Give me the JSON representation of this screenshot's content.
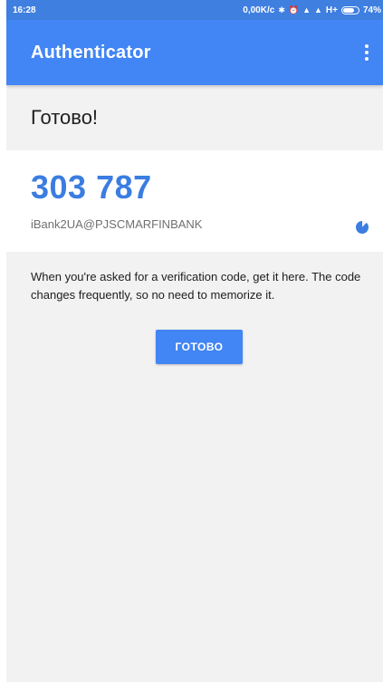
{
  "status_bar": {
    "time": "16:28",
    "network_speed": "0,00K/c",
    "network_type": "H+",
    "battery": "74%",
    "battery_level": 0.74
  },
  "app_bar": {
    "title": "Authenticator"
  },
  "heading": "Готово!",
  "account": {
    "code": "303 787",
    "name": "iBank2UA@PJSCMARFINBANK"
  },
  "info_text": "When you're asked for a verification code, get it here. The code changes frequently, so no need to memorize it.",
  "done_button_label": "ГОТОВО",
  "colors": {
    "accent": "#4285f4",
    "code": "#3b7de0"
  },
  "icons": [
    "bluetooth-icon",
    "alarm-icon",
    "signal-icon",
    "battery-icon",
    "more-vert-icon",
    "countdown-timer-icon"
  ]
}
